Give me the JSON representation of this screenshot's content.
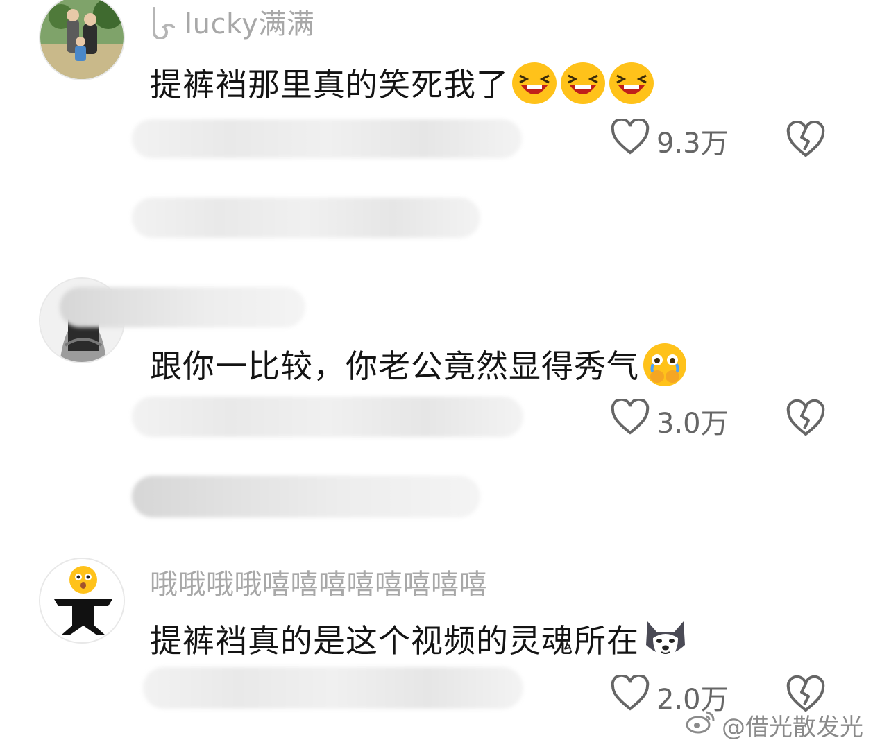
{
  "comments": [
    {
      "username": "lucky满满",
      "text": "提裤裆那里真的笑死我了",
      "emoji": [
        "laughing-face",
        "laughing-face",
        "laughing-face"
      ],
      "likes": "9.3万"
    },
    {
      "username": "",
      "text": "跟你一比较，你老公竟然显得秀气",
      "emoji": [
        "crying-face"
      ],
      "likes": "3.0万"
    },
    {
      "username": "哦哦哦哦嘻嘻嘻嘻嘻嘻嘻嘻",
      "text": "提裤裆真的是这个视频的灵魂所在",
      "emoji": [
        "husky-dog-face"
      ],
      "likes": "2.0万"
    }
  ],
  "watermark": "@借光散发光",
  "colors": {
    "username": "#a8a8a8",
    "text": "#141414",
    "like": "#666666",
    "emoji_yellow": "#ffc21a"
  }
}
